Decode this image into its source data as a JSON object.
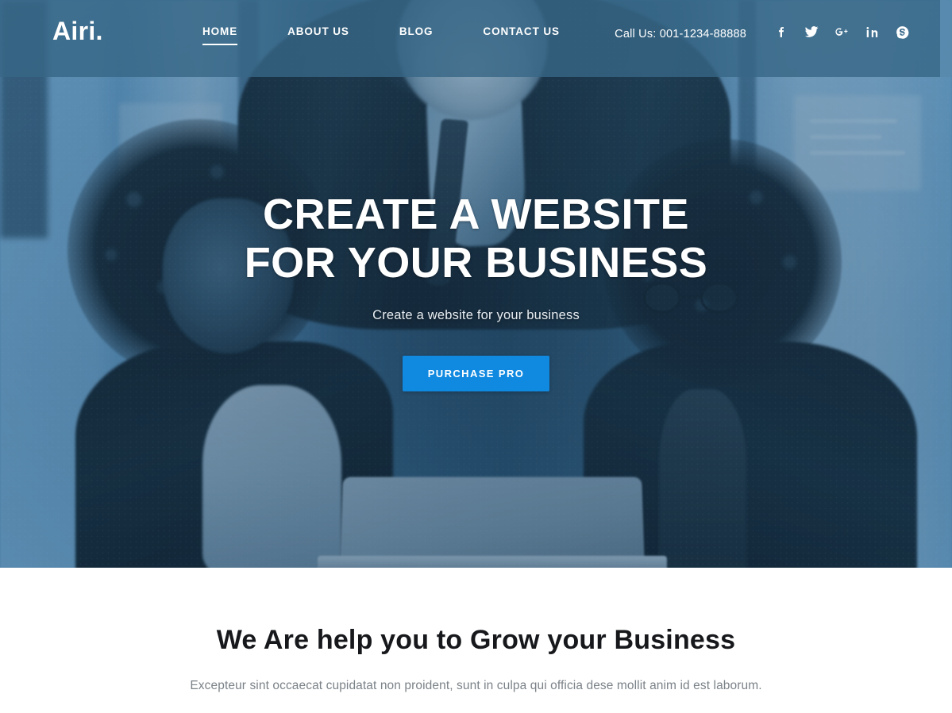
{
  "site": {
    "logo": "Airi."
  },
  "header": {
    "nav": [
      {
        "label": "HOME",
        "active": true
      },
      {
        "label": "ABOUT US",
        "active": false
      },
      {
        "label": "BLOG",
        "active": false
      },
      {
        "label": "CONTACT US",
        "active": false
      }
    ],
    "phone_label": "Call Us: 001-1234-88888",
    "socials": [
      {
        "name": "facebook",
        "title": "Facebook"
      },
      {
        "name": "twitter",
        "title": "Twitter"
      },
      {
        "name": "google-plus",
        "title": "Google Plus"
      },
      {
        "name": "linkedin",
        "title": "LinkedIn"
      },
      {
        "name": "skype",
        "title": "Skype"
      }
    ],
    "bg_color": "#376686"
  },
  "hero": {
    "title_line1": "CREATE A WEBSITE",
    "title_line2": "FOR YOUR BUSINESS",
    "subtitle": "Create a website for your business",
    "cta_label": "PURCHASE PRO",
    "cta_color": "#1089e0",
    "overlay_color": "#134772"
  },
  "about": {
    "heading": "We Are help you to Grow your Business",
    "description": "Excepteur sint occaecat cupidatat non proident, sunt in culpa qui officia dese mollit anim id est laborum."
  }
}
